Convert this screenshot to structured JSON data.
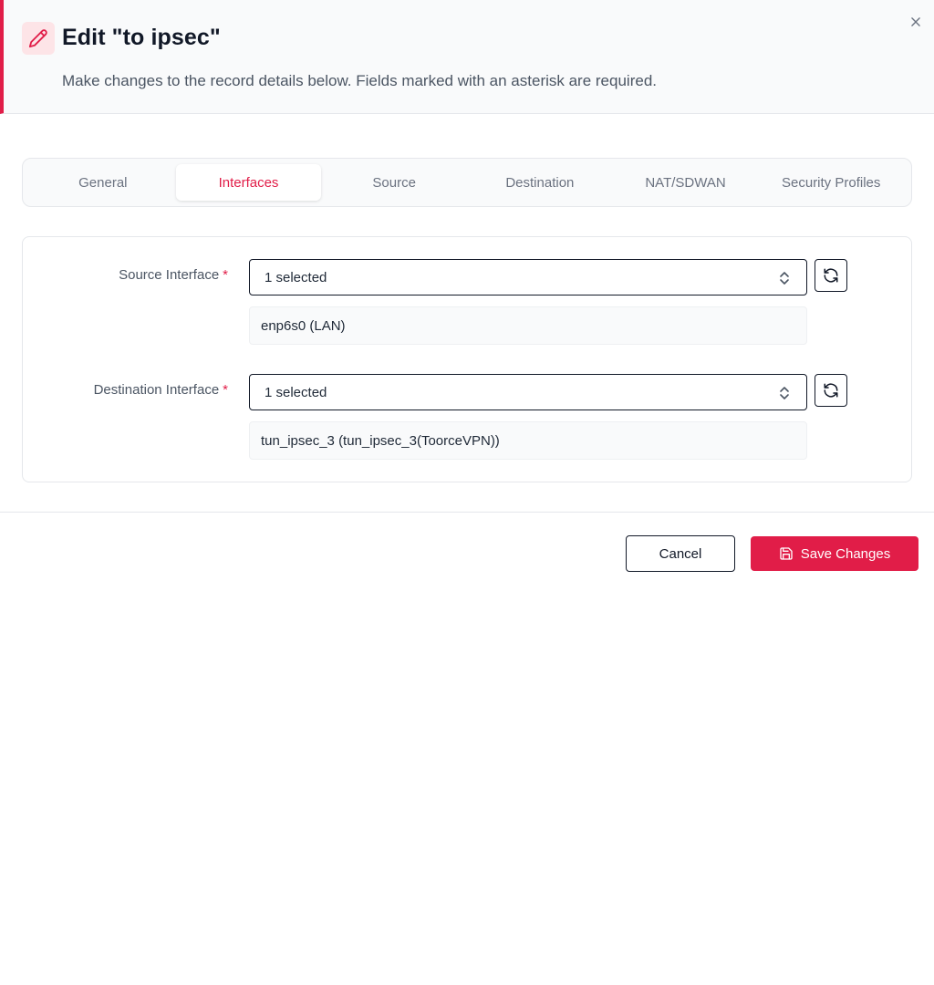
{
  "dialog": {
    "title": "Edit \"to ipsec\"",
    "subtitle": "Make changes to the record details below. Fields marked with an asterisk are required.",
    "accent_color": "#e11d48"
  },
  "tabs": [
    {
      "label": "General",
      "active": false
    },
    {
      "label": "Interfaces",
      "active": true
    },
    {
      "label": "Source",
      "active": false
    },
    {
      "label": "Destination",
      "active": false
    },
    {
      "label": "NAT/SDWAN",
      "active": false
    },
    {
      "label": "Security Profiles",
      "active": false
    }
  ],
  "fields": {
    "source_interface": {
      "label": "Source Interface",
      "required_mark": "*",
      "selected_text": "1 selected",
      "selected_items": [
        "enp6s0 (LAN)"
      ]
    },
    "destination_interface": {
      "label": "Destination Interface",
      "required_mark": "*",
      "selected_text": "1 selected",
      "selected_items": [
        "tun_ipsec_3 (tun_ipsec_3(ToorceVPN))"
      ]
    }
  },
  "footer": {
    "cancel_label": "Cancel",
    "save_label": "Save Changes"
  },
  "icons": {
    "header": "pencil-icon",
    "close": "close-icon",
    "select_chevron": "chevron-up-down-icon",
    "refresh": "refresh-icon",
    "save": "save-icon"
  }
}
